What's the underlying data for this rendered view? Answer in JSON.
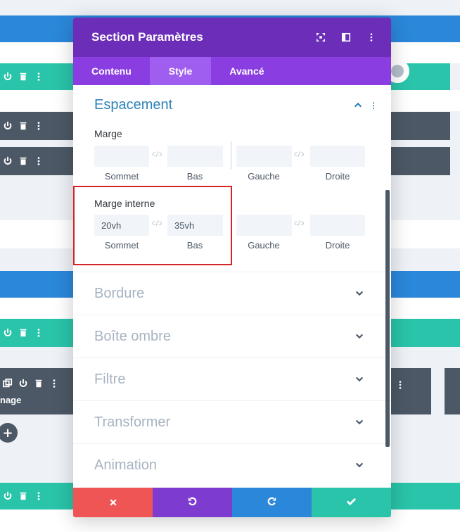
{
  "modal": {
    "title": "Section Paramètres",
    "header_icons": [
      "fullscreen-icon",
      "split-view-icon",
      "more-vertical-icon"
    ],
    "tabs": [
      {
        "label": "Contenu"
      },
      {
        "label": "Style",
        "active": true
      },
      {
        "label": "Avancé"
      }
    ]
  },
  "spacing": {
    "title": "Espacement",
    "margin": {
      "label": "Marge",
      "fields": [
        {
          "label": "Sommet",
          "value": ""
        },
        {
          "label": "Bas",
          "value": ""
        },
        {
          "label": "Gauche",
          "value": ""
        },
        {
          "label": "Droite",
          "value": ""
        }
      ]
    },
    "padding": {
      "label": "Marge interne",
      "fields": [
        {
          "label": "Sommet",
          "value": "20vh"
        },
        {
          "label": "Bas",
          "value": "35vh"
        },
        {
          "label": "Gauche",
          "value": ""
        },
        {
          "label": "Droite",
          "value": ""
        }
      ]
    }
  },
  "toggles": [
    {
      "label": "Bordure"
    },
    {
      "label": "Boîte ombre"
    },
    {
      "label": "Filtre"
    },
    {
      "label": "Transformer"
    },
    {
      "label": "Animation"
    }
  ],
  "footer": {
    "buttons": [
      "cancel-icon",
      "undo-icon",
      "redo-icon",
      "save-check-icon"
    ],
    "colors": [
      "#ef5555",
      "#7d3bcf",
      "#2b87da",
      "#29c4a9"
    ]
  },
  "background": {
    "partial_label": "nage"
  },
  "colors": {
    "header": "#6c2eb9",
    "tabs": "#8a3ee1",
    "accent_blue": "#2e82b8",
    "teal": "#29c4a9",
    "slate": "#4c5866",
    "highlight_red": "#d7232a"
  }
}
